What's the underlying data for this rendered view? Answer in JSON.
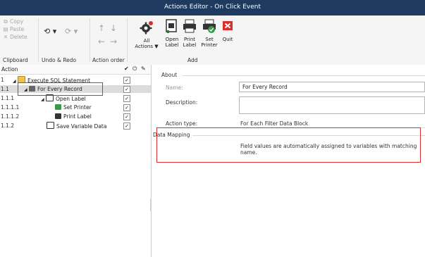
{
  "window": {
    "title": "Actions Editor - On Click Event"
  },
  "ribbon": {
    "clipboard": {
      "copy": "Copy",
      "paste": "Paste",
      "delete": "Delete",
      "group_label": "Clipboard"
    },
    "undo_redo": {
      "undo_arrow": "⟲ ▾",
      "redo_arrow": "⟳ ▾",
      "group_label": "Undo & Redo"
    },
    "action_order": {
      "group_label": "Action order"
    },
    "all_actions": {
      "line1": "All",
      "line2": "Actions ▼"
    },
    "add": {
      "open_label": [
        "Open",
        "Label"
      ],
      "print_label": [
        "Print",
        "Label"
      ],
      "set_printer": [
        "Set",
        "Printer"
      ],
      "quit": "Quit",
      "group_label": "Add"
    }
  },
  "tree": {
    "header": {
      "action": "Action",
      "icon_check": "✔",
      "icon_power": "⏻",
      "icon_edit": "✎"
    },
    "rows": [
      {
        "num": "1",
        "label": "Execute SQL Statement",
        "checked": "✓"
      },
      {
        "num": "1.1",
        "label": "For Every Record",
        "checked": "✓"
      },
      {
        "num": "1.1.1",
        "label": "Open Label",
        "checked": "✓"
      },
      {
        "num": "1.1.1.1",
        "label": "Set Printer",
        "checked": "✓"
      },
      {
        "num": "1.1.1.2",
        "label": "Print Label",
        "checked": "✓"
      },
      {
        "num": "1.1.2",
        "label": "Save Variable Data",
        "checked": "✓"
      }
    ]
  },
  "details": {
    "about_section": "About",
    "name_label": "Name:",
    "name_value": "For Every Record",
    "description_label": "Description:",
    "description_value": "",
    "action_type_label": "Action type:",
    "action_type_value": "For Each Filter Data Block",
    "data_mapping_section": "Data Mapping",
    "data_mapping_text": "Field values are automatically assigned to variables with matching name."
  },
  "colors": {
    "title_bar": "#1e3a5f",
    "highlight": "#d9302e",
    "quit_red": "#d9302e"
  }
}
